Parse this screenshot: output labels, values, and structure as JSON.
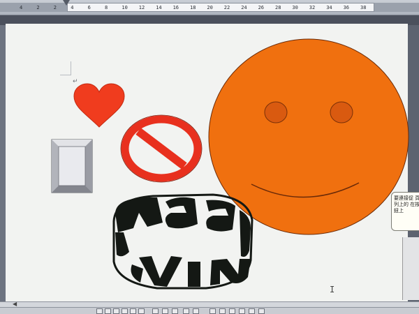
{
  "ruler": {
    "ticks": [
      "4",
      "2",
      "2",
      "4",
      "6",
      "8",
      "10",
      "12",
      "14",
      "16",
      "18",
      "20",
      "22",
      "24",
      "26",
      "28",
      "30",
      "32",
      "34",
      "36",
      "38"
    ]
  },
  "document": {
    "paragraph_mark": "↵",
    "cursor_glyph": "I"
  },
  "callout": {
    "text": "要連接促 頁列上的 在按鈕上"
  },
  "wordart": {
    "text": "Ha VI"
  },
  "colors": {
    "smiley_fill": "#f0700f",
    "heart_fill": "#f03c1e",
    "no_sign": "#e8301e",
    "wordart_fill": "#141814"
  },
  "icons": {
    "smiley": "smiley-face-shape",
    "heart": "heart-shape",
    "no_symbol": "no-symbol-shape",
    "bevel": "bevel-shape",
    "wordart": "wordart-ring"
  }
}
